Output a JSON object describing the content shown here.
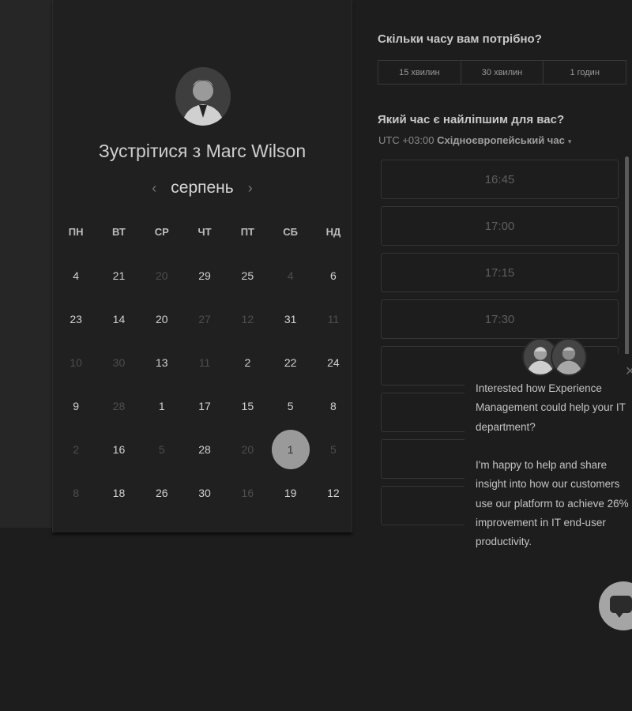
{
  "host": {
    "title_prefix": "Зустрітися з ",
    "name": "Marc Wilson"
  },
  "calendar": {
    "month": "серпень",
    "prev_icon": "‹",
    "next_icon": "›",
    "weekdays": [
      "ПН",
      "ВТ",
      "СР",
      "ЧТ",
      "ПТ",
      "СБ",
      "НД"
    ],
    "days": [
      {
        "label": "4",
        "available": true
      },
      {
        "label": "21",
        "available": true
      },
      {
        "label": "20",
        "available": false
      },
      {
        "label": "29",
        "available": true
      },
      {
        "label": "25",
        "available": true
      },
      {
        "label": "4",
        "available": false
      },
      {
        "label": "6",
        "available": true
      },
      {
        "label": "23",
        "available": true
      },
      {
        "label": "14",
        "available": true
      },
      {
        "label": "20",
        "available": true
      },
      {
        "label": "27",
        "available": false
      },
      {
        "label": "12",
        "available": false
      },
      {
        "label": "31",
        "available": true
      },
      {
        "label": "11",
        "available": false
      },
      {
        "label": "10",
        "available": false
      },
      {
        "label": "30",
        "available": false
      },
      {
        "label": "13",
        "available": true
      },
      {
        "label": "11",
        "available": false
      },
      {
        "label": "2",
        "available": true
      },
      {
        "label": "22",
        "available": true
      },
      {
        "label": "24",
        "available": true
      },
      {
        "label": "9",
        "available": true
      },
      {
        "label": "28",
        "available": false
      },
      {
        "label": "1",
        "available": true
      },
      {
        "label": "17",
        "available": true
      },
      {
        "label": "15",
        "available": true
      },
      {
        "label": "5",
        "available": true
      },
      {
        "label": "8",
        "available": true
      },
      {
        "label": "2",
        "available": false
      },
      {
        "label": "16",
        "available": true
      },
      {
        "label": "5",
        "available": false
      },
      {
        "label": "28",
        "available": true
      },
      {
        "label": "20",
        "available": false
      },
      {
        "label": "1",
        "available": true,
        "selected": true
      },
      {
        "label": "5",
        "available": false
      },
      {
        "label": "8",
        "available": false
      },
      {
        "label": "18",
        "available": true
      },
      {
        "label": "26",
        "available": true
      },
      {
        "label": "30",
        "available": true
      },
      {
        "label": "16",
        "available": false
      },
      {
        "label": "19",
        "available": true
      },
      {
        "label": "12",
        "available": true
      }
    ]
  },
  "duration": {
    "question": "Скільки часу вам потрібно?",
    "options": [
      "15 хвилин",
      "30 хвилин",
      "1 годин"
    ]
  },
  "times": {
    "question": "Який час є найліпшим для вас?",
    "tz_offset": "UTC +03:00",
    "tz_name": "Східноєвропейський час",
    "tz_caret": "▾",
    "slots": [
      "16:45",
      "17:00",
      "17:15",
      "17:30",
      "",
      "",
      "",
      ""
    ]
  },
  "chat": {
    "close_icon": "✕",
    "message": "Interested how Experience Management could help your IT department?\n\nI'm happy to help and share insight into how our customers use our platform to achieve 26% improvement in IT end-user productivity."
  },
  "colors": {
    "background": "#1d1d1d",
    "card": "#202020",
    "selected_day": "#9a9a9a",
    "launcher": "#a5a5a5"
  }
}
